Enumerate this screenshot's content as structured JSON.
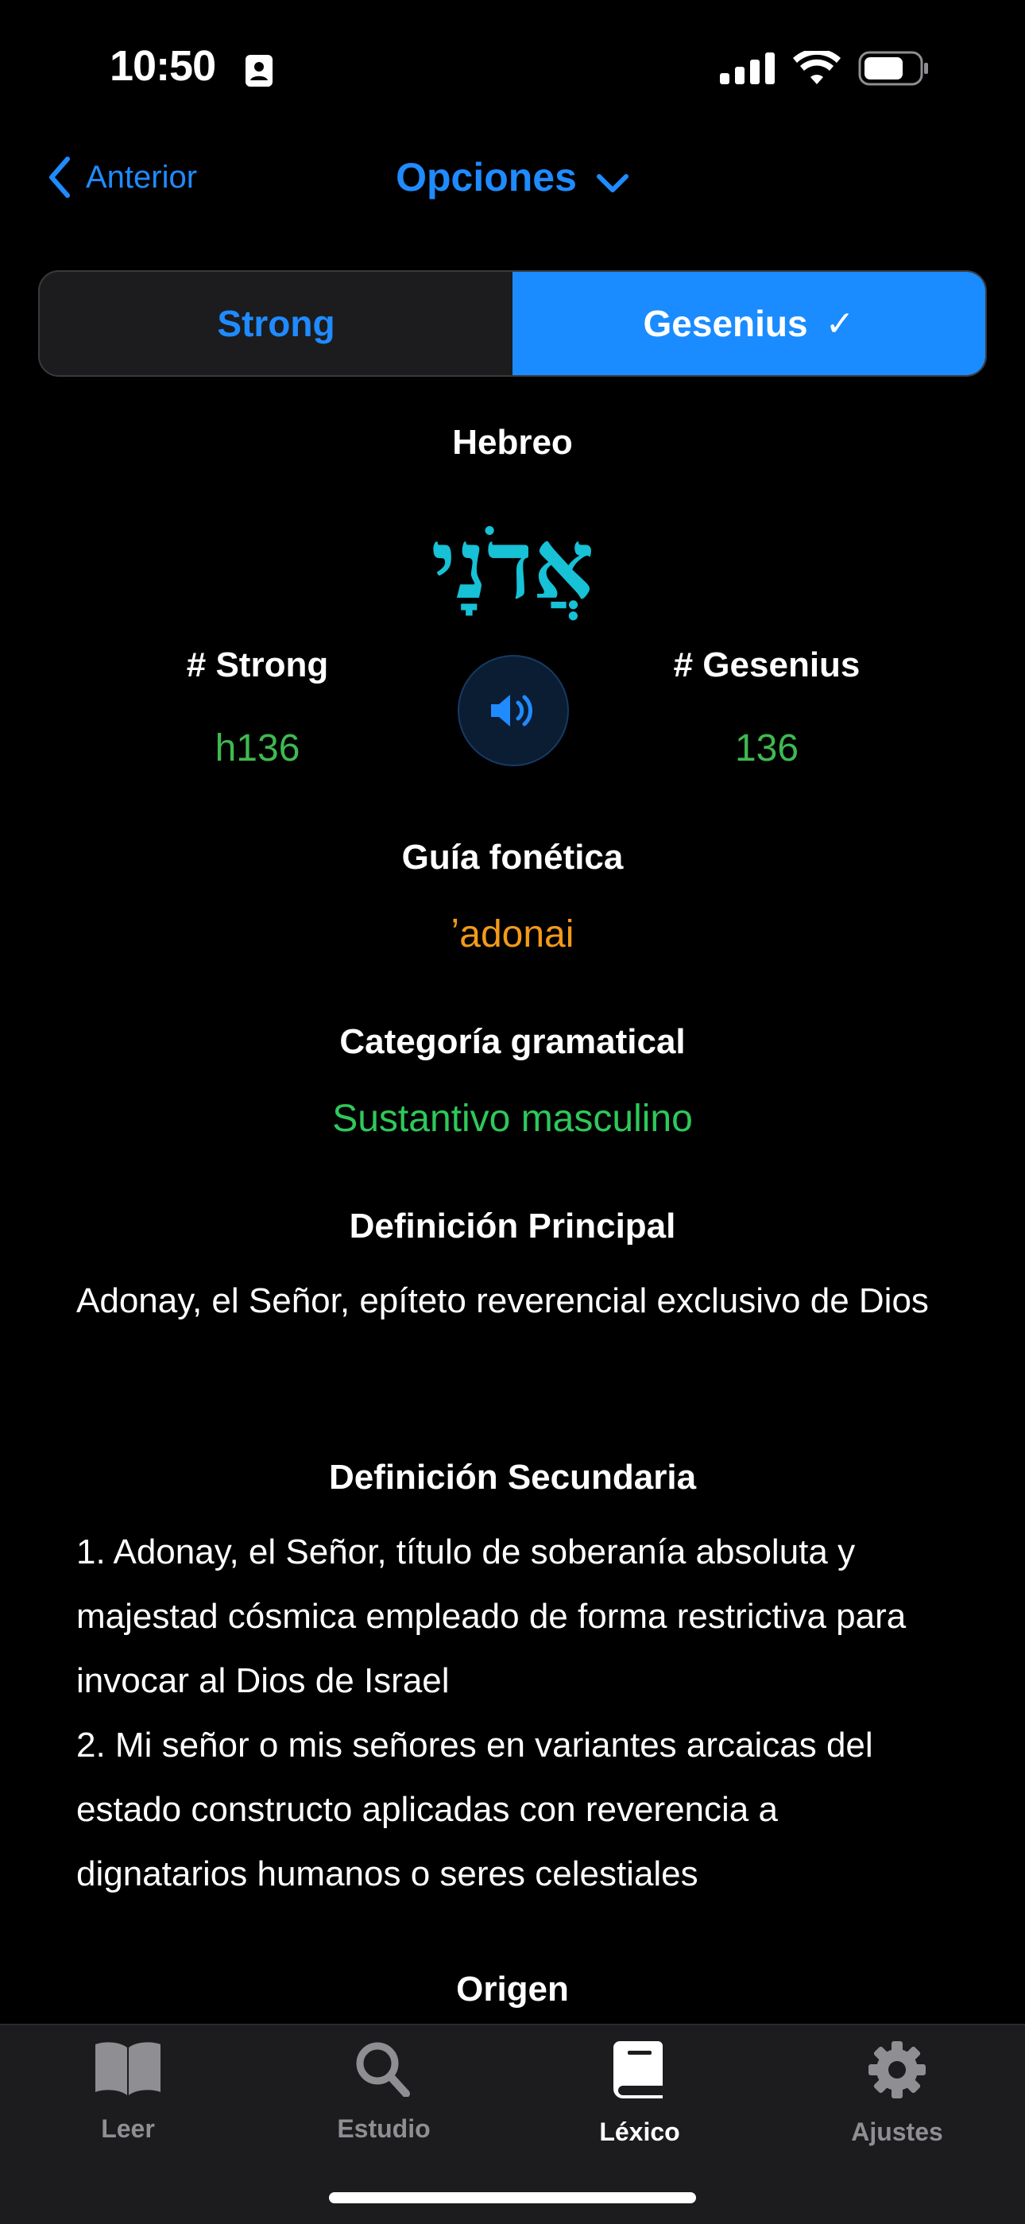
{
  "status": {
    "time": "10:50"
  },
  "nav": {
    "back_label": "Anterior",
    "title": "Opciones"
  },
  "segmented": {
    "left_label": "Strong",
    "right_label": "Gesenius",
    "right_check": "✓"
  },
  "entry": {
    "language_label": "Hebreo",
    "hebrew_word": "אֲדֹנָי",
    "strong_label": "# Strong",
    "strong_value": "h136",
    "gesenius_label": "# Gesenius",
    "gesenius_value": "136",
    "phonetic_label": "Guía fonética",
    "phonetic_value": "ʼadonai",
    "grammar_label": "Categoría gramatical",
    "grammar_value": "Sustantivo masculino",
    "primary_label": "Definición Principal",
    "primary_text": "Adonay, el Señor, epíteto reverencial exclusivo de Dios",
    "secondary_label": "Definición Secundaria",
    "secondary_items": [
      "1. Adonay, el Señor, título de soberanía absoluta y majestad cósmica empleado de forma restrictiva para invocar al Dios de Israel",
      "2. Mi señor o mis señores en variantes arcaicas del estado constructo aplicadas con reverencia a dignatarios humanos o seres celestiales"
    ],
    "origin_label": "Origen"
  },
  "tabs": [
    {
      "label": "Leer",
      "icon": "book-open-icon"
    },
    {
      "label": "Estudio",
      "icon": "search-icon"
    },
    {
      "label": "Léxico",
      "icon": "book-closed-icon"
    },
    {
      "label": "Ajustes",
      "icon": "gear-icon"
    }
  ],
  "colors": {
    "accent": "#1a8cff",
    "hebrew": "#17c1d6",
    "number": "#3fb950",
    "phonetic": "#f39a1a",
    "grammar": "#2fc85a"
  }
}
